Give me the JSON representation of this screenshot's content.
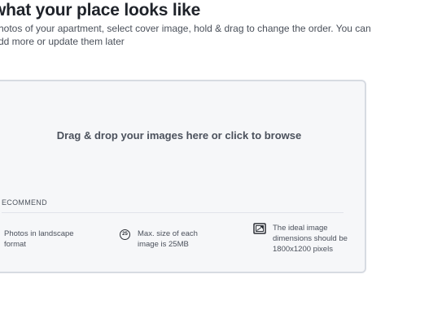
{
  "header": {
    "title": "what your place looks like",
    "subtitle": "hotos of your apartment, select cover image, hold & drag to change the order. You can dd more or update them later"
  },
  "dropzone": {
    "prompt": "Drag & drop your images here or click to browse",
    "recommend_label": "ECOMMEND",
    "recommendations": [
      {
        "icon": "landscape-icon",
        "text": "Photos in landscape format"
      },
      {
        "icon": "size-25-icon",
        "icon_text": "25",
        "text": "Max. size of each image is 25MB"
      },
      {
        "icon": "dimensions-icon",
        "text": "The ideal image dimensions should be 1800x1200 pixels"
      }
    ]
  },
  "colors": {
    "dropzone_bg": "#f6f7f9",
    "dropzone_border": "#d7dbe2",
    "text_dark": "#1f232a",
    "text_muted": "#4b515c"
  }
}
